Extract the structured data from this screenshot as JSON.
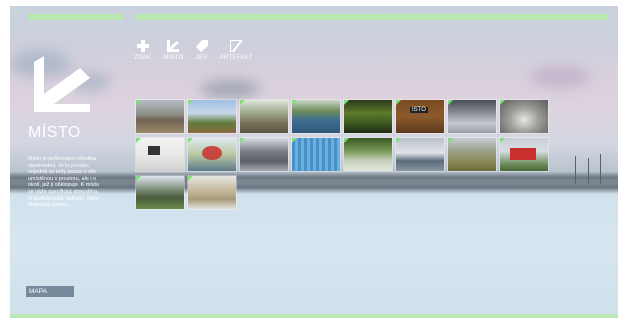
{
  "nav": {
    "items": [
      {
        "label": "ZNAK",
        "icon": "plus-icon"
      },
      {
        "label": "MÍSTO",
        "icon": "arrow-icon"
      },
      {
        "label": "JEV",
        "icon": "tag-icon"
      },
      {
        "label": "ARTEFAKT",
        "icon": "flag-icon"
      }
    ]
  },
  "section": {
    "title": "MÍSTO",
    "description": "Místo je definováno několika vlastnostmi. Je to prostor, nejedná se tedy pouze o věc umístěnou v prostoru, ale i o okolí, jež ji obklopuje. K místu se váže specifická atmosféra, či společenská, kulturní, nebo historická funkce."
  },
  "map_button": {
    "label": "MAPA"
  },
  "colors": {
    "accent": "#b9e9b0",
    "tag": "#7ee07a"
  },
  "sign_text": "ISTO"
}
